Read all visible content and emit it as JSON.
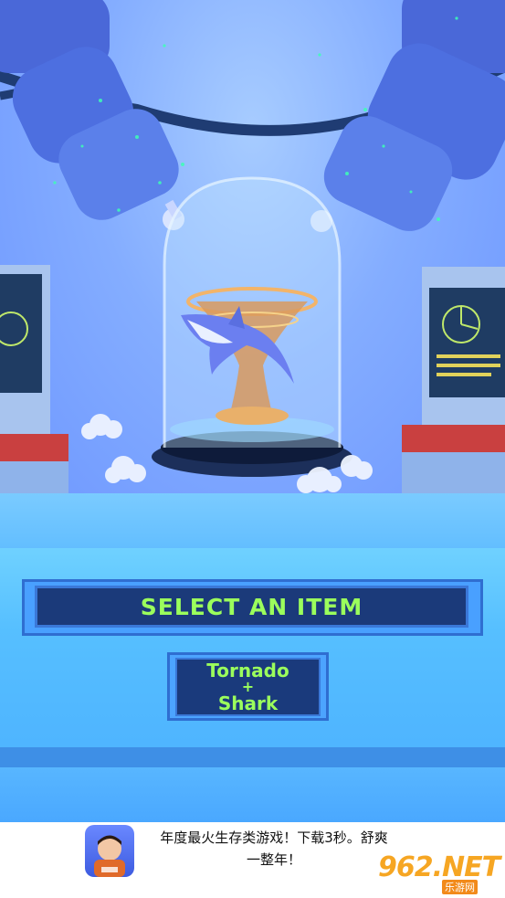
{
  "game": {
    "title": "SELECT AN ITEM",
    "item": {
      "line1": "Tornado",
      "line2": "+",
      "line3": "Shark"
    }
  },
  "ad": {
    "text_line1": "年度最火生存类游戏！下载3秒。舒爽",
    "text_line2": "一整年！"
  },
  "watermark": {
    "brand": "962.NET",
    "tag": "乐游网"
  },
  "colors": {
    "accent_text": "#9bff5c",
    "panel_dark": "#1b3a7a",
    "panel_border": "#49a0ff"
  }
}
